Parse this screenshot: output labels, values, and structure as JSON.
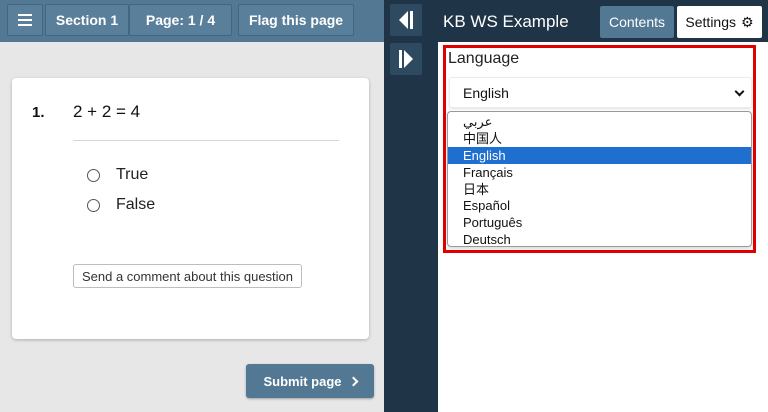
{
  "toolbar": {
    "section_label": "Section 1",
    "page_label": "Page: 1 / 4",
    "flag_label": "Flag this page"
  },
  "question": {
    "number": "1.",
    "text": "2 + 2 = 4",
    "options": [
      "True",
      "False"
    ],
    "comment_button": "Send a comment about this question"
  },
  "submit_label": "Submit page",
  "panel": {
    "title": "KB WS Example",
    "tabs": {
      "contents": "Contents",
      "settings": "Settings"
    }
  },
  "settings": {
    "language_label": "Language",
    "selected_language": "English",
    "language_options": [
      "عربي",
      "中国人",
      "English",
      "Français",
      "日本",
      "Español",
      "Português",
      "Deutsch"
    ],
    "highlight_color": "#e10000",
    "selected_option_color": "#1f6fd0"
  },
  "colors": {
    "toolbar": "#527893",
    "dark_panel": "#1f3446",
    "background": "#e7e7e7"
  }
}
